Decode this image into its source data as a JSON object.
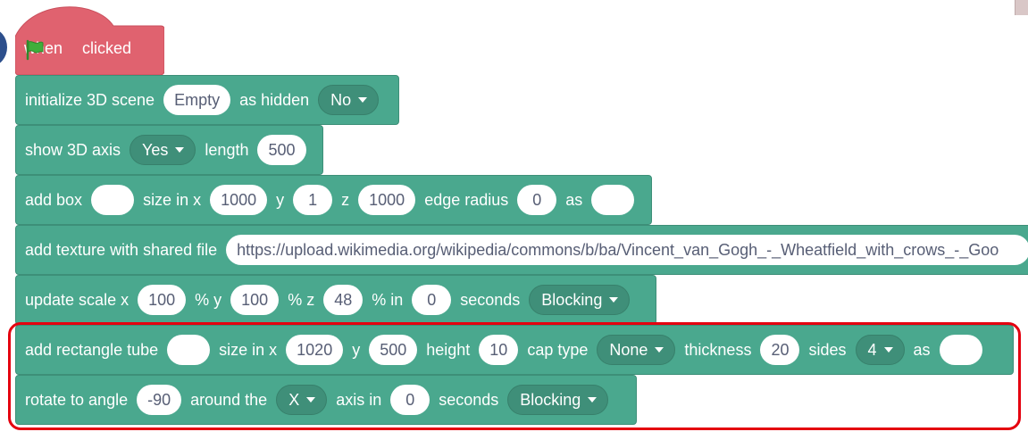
{
  "hat": {
    "when": "when",
    "clicked": "clicked",
    "flag_color": "#3fae3b",
    "color": "#e0626f"
  },
  "blocks": {
    "init": {
      "label": "initialize 3D scene",
      "scene": "Empty",
      "as_hidden": "as hidden",
      "hidden": "No"
    },
    "axis": {
      "label": "show 3D axis",
      "value": "Yes",
      "length_label": "length",
      "length": "500"
    },
    "box": {
      "label": "add box",
      "name": "",
      "size_x_label": "size in x",
      "x": "1000",
      "y_label": "y",
      "y": "1",
      "z_label": "z",
      "z": "1000",
      "edge_label": "edge radius",
      "edge": "0",
      "as_label": "as",
      "as": ""
    },
    "texture": {
      "label": "add texture with shared file",
      "url": "https://upload.wikimedia.org/wikipedia/commons/b/ba/Vincent_van_Gogh_-_Wheatfield_with_crows_-_Goo"
    },
    "scale": {
      "label": "update scale x",
      "x": "100",
      "y_label": "% y",
      "y": "100",
      "z_label": "% z",
      "z": "48",
      "in_label": "% in",
      "seconds_value": "0",
      "seconds_label": "seconds",
      "mode": "Blocking"
    },
    "tube": {
      "label": "add rectangle tube",
      "name": "",
      "size_x_label": "size in x",
      "x": "1020",
      "y_label": "y",
      "y": "500",
      "height_label": "height",
      "height": "10",
      "cap_label": "cap type",
      "cap": "None",
      "thickness_label": "thickness",
      "thickness": "20",
      "sides_label": "sides",
      "sides": "4",
      "as_label": "as",
      "as": ""
    },
    "rotate": {
      "label": "rotate to angle",
      "angle": "-90",
      "around_label": "around the",
      "axis": "X",
      "axis_in_label": "axis in",
      "seconds_value": "0",
      "seconds_label": "seconds",
      "mode": "Blocking"
    }
  },
  "colors": {
    "block": "#4aa88e",
    "dropdown": "#3f8f79",
    "highlight": "#e4000f"
  }
}
